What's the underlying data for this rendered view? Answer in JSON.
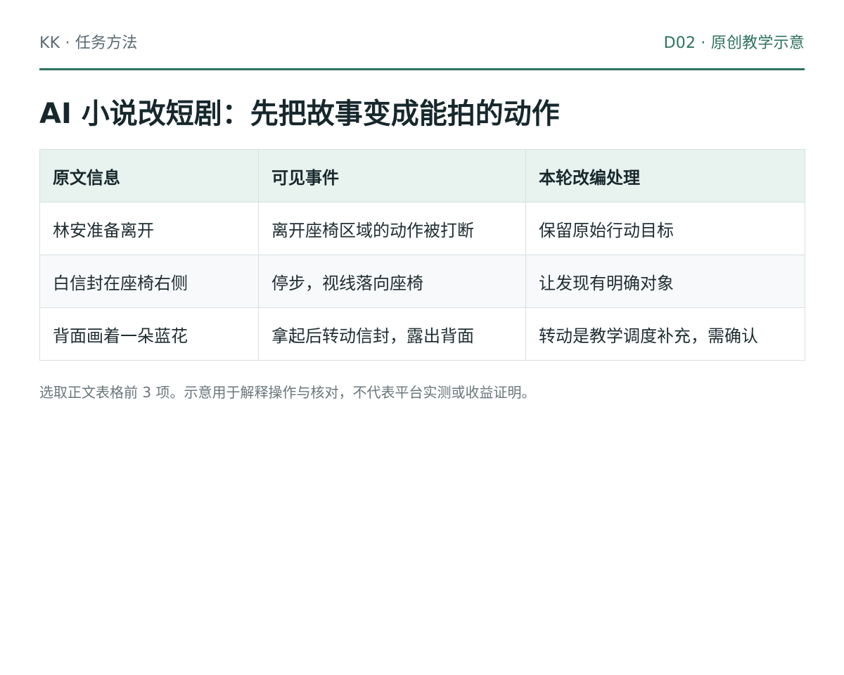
{
  "header": {
    "brand": "KK · 任务方法",
    "tag": "D02 · 原创教学示意"
  },
  "title": "AI 小说改短剧：先把故事变成能拍的动作",
  "table": {
    "columns": [
      "原文信息",
      "可见事件",
      "本轮改编处理"
    ],
    "rows": [
      [
        "林安准备离开",
        "离开座椅区域的动作被打断",
        "保留原始行动目标"
      ],
      [
        "白信封在座椅右侧",
        "停步，视线落向座椅",
        "让发现有明确对象"
      ],
      [
        "背面画着一朵蓝花",
        "拿起后转动信封，露出背面",
        "转动是教学调度补充，需确认"
      ]
    ]
  },
  "note": "选取正文表格前 3 项。示意用于解释操作与核对，不代表平台实测或收益证明。",
  "colors": {
    "accent": "#2e7260",
    "header_bg": "#e8f2ee",
    "border": "#d9dfe1"
  }
}
